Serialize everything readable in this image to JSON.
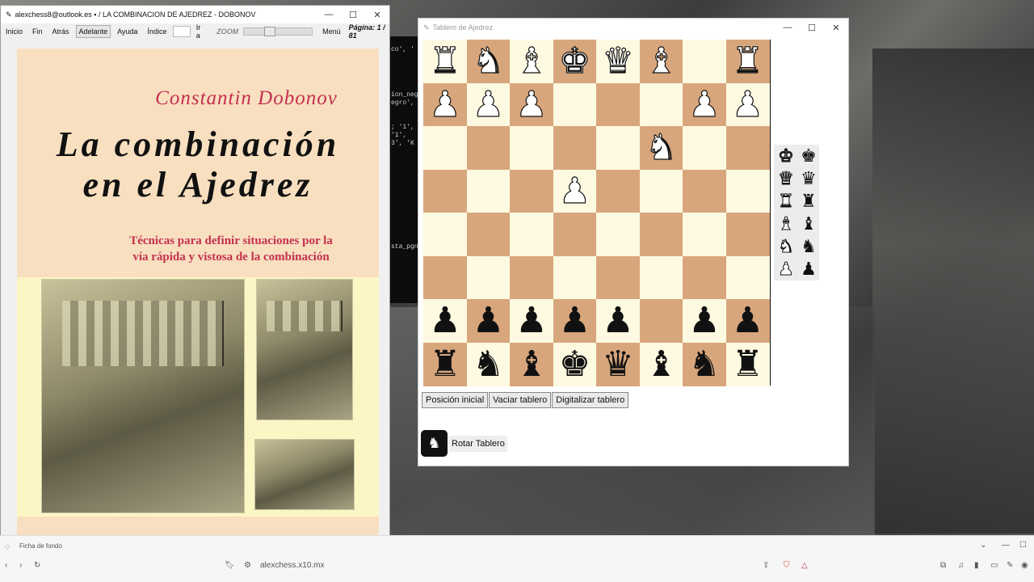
{
  "pdf_window": {
    "title": "alexchess8@outlook.es",
    "title_rest": "/ LA COMBINACION DE AJEDREZ - DOBONOV",
    "toolbar": {
      "inicio": "Inicio",
      "fin": "Fin",
      "atras": "Atrás",
      "adelante": "Adelante",
      "ayuda": "Ayuda",
      "indice": "Índice",
      "ira": "Ir a",
      "zoom": "ZOOM",
      "menu": "Menú",
      "pagina": "Página: 1 / 81"
    },
    "zoom_level_fraction": 0.3,
    "page": {
      "author": "Constantin Dobonov",
      "title_line1": "La combinación",
      "title_line2": "en el Ajedrez",
      "subtitle_line1": "Técnicas para definir situaciones por la",
      "subtitle_line2": "vía rápida y vistosa de la combinación"
    }
  },
  "chess_window": {
    "title": "Tablero de Ajedrez",
    "board": [
      [
        "wR",
        "wN",
        "wB",
        "wK",
        "wQ",
        "wB",
        "",
        "wR"
      ],
      [
        "wP",
        "wP",
        "wP",
        "",
        "",
        "",
        "wP",
        "wP"
      ],
      [
        "",
        "",
        "",
        "",
        "",
        "wN",
        "",
        ""
      ],
      [
        "",
        "",
        "",
        "wP",
        "",
        "",
        "",
        ""
      ],
      [
        "",
        "",
        "",
        "",
        "",
        "",
        "",
        ""
      ],
      [
        "",
        "",
        "",
        "",
        "",
        "",
        "",
        ""
      ],
      [
        "bP",
        "bP",
        "bP",
        "bP",
        "bP",
        "",
        "bP",
        "bP"
      ],
      [
        "bR",
        "bN",
        "bB",
        "bK",
        "bQ",
        "bB",
        "bN",
        "bR"
      ]
    ],
    "palette": [
      [
        "wK",
        "bK"
      ],
      [
        "wQ",
        "bQ"
      ],
      [
        "wR",
        "bR"
      ],
      [
        "wB",
        "bB"
      ],
      [
        "wN",
        "bN"
      ],
      [
        "wP",
        "bP"
      ]
    ],
    "buttons": {
      "inicial": "Posición inicial",
      "vaciar": "Vaciar tablero",
      "digitalizar": "Digitalizar tablero",
      "rotar": "Rotar Tablero"
    }
  },
  "console": {
    "lines": [
      "co', '",
      "ion_negr",
      "egro',",
      "; '1',",
      "'1',",
      "3', 'K",
      "sta_pgn"
    ]
  },
  "browser": {
    "url": "alexchess.x10.mx",
    "tab_label": "Ficha de fondo"
  }
}
